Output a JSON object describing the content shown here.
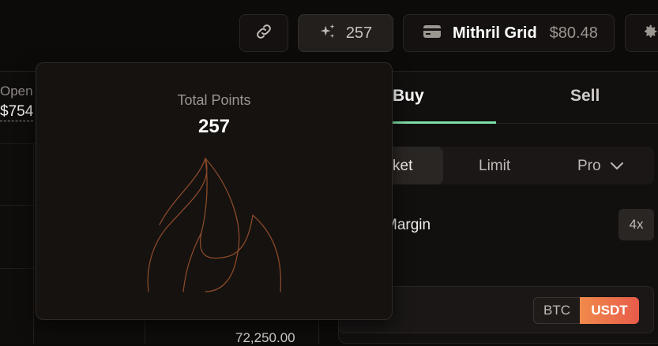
{
  "topbar": {
    "points_value": "257",
    "wallet_name": "Mithril Grid",
    "wallet_balance": "$80.48",
    "icons": {
      "link": "link-icon",
      "sparkle": "sparkle-icon",
      "wallet": "wallet-icon",
      "settings": "gear-icon"
    }
  },
  "market": {
    "open_label": "Open",
    "open_value": "$754",
    "price_label": "72,250.00"
  },
  "popover": {
    "title": "Total Points",
    "value": "257",
    "icon": "flame-icon"
  },
  "trade": {
    "tabs": {
      "buy": "Buy",
      "sell": "Sell"
    },
    "order_types": {
      "market": "ket",
      "limit": "Limit",
      "pro": "Pro"
    },
    "margin_label": "Margin",
    "leverage": "4x",
    "currencies": {
      "btc": "BTC",
      "usdt": "USDT"
    }
  },
  "colors": {
    "accent_green": "#7ee0a6",
    "usdt_gradient_start": "#f08a4b",
    "usdt_gradient_end": "#e85b4a",
    "flame_stroke": "#8a4a2a"
  }
}
